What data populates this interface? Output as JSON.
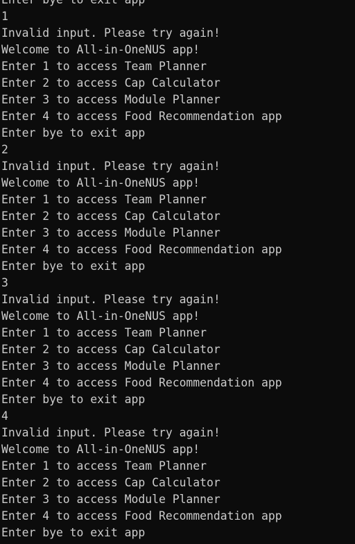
{
  "console": {
    "lines": [
      "Enter bye to exit app",
      "1",
      "Invalid input. Please try again!",
      "Welcome to All-in-OneNUS app!",
      "Enter 1 to access Team Planner",
      "Enter 2 to access Cap Calculator",
      "Enter 3 to access Module Planner",
      "Enter 4 to access Food Recommendation app",
      "Enter bye to exit app",
      "2",
      "Invalid input. Please try again!",
      "Welcome to All-in-OneNUS app!",
      "Enter 1 to access Team Planner",
      "Enter 2 to access Cap Calculator",
      "Enter 3 to access Module Planner",
      "Enter 4 to access Food Recommendation app",
      "Enter bye to exit app",
      "3",
      "Invalid input. Please try again!",
      "Welcome to All-in-OneNUS app!",
      "Enter 1 to access Team Planner",
      "Enter 2 to access Cap Calculator",
      "Enter 3 to access Module Planner",
      "Enter 4 to access Food Recommendation app",
      "Enter bye to exit app",
      "4",
      "Invalid input. Please try again!",
      "Welcome to All-in-OneNUS app!",
      "Enter 1 to access Team Planner",
      "Enter 2 to access Cap Calculator",
      "Enter 3 to access Module Planner",
      "Enter 4 to access Food Recommendation app",
      "Enter bye to exit app"
    ]
  },
  "colors": {
    "background": "#0c0c0c",
    "text": "#cccccc"
  }
}
